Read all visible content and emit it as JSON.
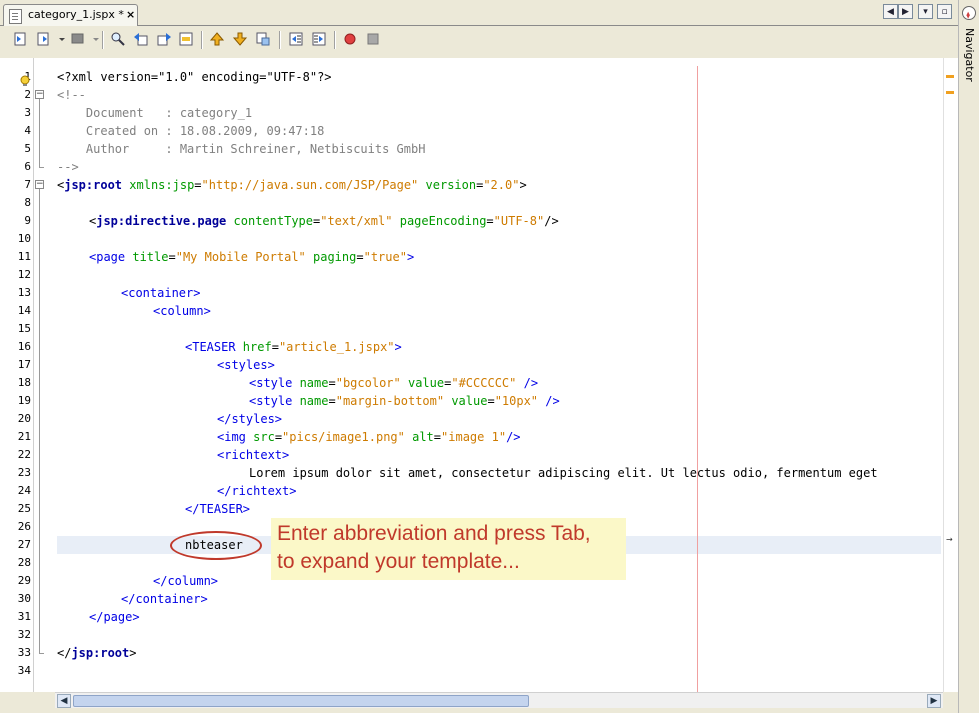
{
  "tab": {
    "title": "category_1.jspx *",
    "close_glyph": "×"
  },
  "navigator": {
    "label": "Navigator"
  },
  "tab_nav": {
    "left": "◀",
    "right": "▶",
    "menu": "▾",
    "maximize": "▫"
  },
  "editor": {
    "lines": [
      {
        "n": "1",
        "indent": 0,
        "segs": [
          {
            "c": "tx",
            "t": "<?xml version=\"1.0\" encoding=\"UTF-8\"?>"
          }
        ]
      },
      {
        "n": "2",
        "indent": 0,
        "segs": [
          {
            "c": "cm",
            "t": "<!--"
          }
        ]
      },
      {
        "n": "3",
        "indent": 0,
        "segs": [
          {
            "c": "cm",
            "t": "    Document   : category_1"
          }
        ]
      },
      {
        "n": "4",
        "indent": 0,
        "segs": [
          {
            "c": "cm",
            "t": "    Created on : 18.08.2009, 09:47:18"
          }
        ]
      },
      {
        "n": "5",
        "indent": 0,
        "segs": [
          {
            "c": "cm",
            "t": "    Author     : Martin Schreiner, Netbiscuits GmbH"
          }
        ]
      },
      {
        "n": "6",
        "indent": 0,
        "segs": [
          {
            "c": "cm",
            "t": "-->"
          }
        ]
      },
      {
        "n": "7",
        "indent": 0,
        "segs": [
          {
            "c": "tx",
            "t": "<"
          },
          {
            "c": "kw",
            "t": "jsp:root"
          },
          {
            "c": "tx",
            "t": " "
          },
          {
            "c": "attr",
            "t": "xmlns:jsp"
          },
          {
            "c": "tx",
            "t": "="
          },
          {
            "c": "val",
            "t": "\"http://java.sun.com/JSP/Page\""
          },
          {
            "c": "tx",
            "t": " "
          },
          {
            "c": "attr",
            "t": "version"
          },
          {
            "c": "tx",
            "t": "="
          },
          {
            "c": "val",
            "t": "\"2.0\""
          },
          {
            "c": "tx",
            "t": ">"
          }
        ]
      },
      {
        "n": "8",
        "indent": 0,
        "segs": []
      },
      {
        "n": "9",
        "indent": 1,
        "segs": [
          {
            "c": "tx",
            "t": "<"
          },
          {
            "c": "kw",
            "t": "jsp:directive.page"
          },
          {
            "c": "tx",
            "t": " "
          },
          {
            "c": "attr",
            "t": "contentType"
          },
          {
            "c": "tx",
            "t": "="
          },
          {
            "c": "val",
            "t": "\"text/xml\""
          },
          {
            "c": "tx",
            "t": " "
          },
          {
            "c": "attr",
            "t": "pageEncoding"
          },
          {
            "c": "tx",
            "t": "="
          },
          {
            "c": "val",
            "t": "\"UTF-8\""
          },
          {
            "c": "tx",
            "t": "/>"
          }
        ]
      },
      {
        "n": "10",
        "indent": 0,
        "segs": []
      },
      {
        "n": "11",
        "indent": 1,
        "segs": [
          {
            "c": "tag",
            "t": "<page "
          },
          {
            "c": "attr",
            "t": "title"
          },
          {
            "c": "tx",
            "t": "="
          },
          {
            "c": "val",
            "t": "\"My Mobile Portal\""
          },
          {
            "c": "tx",
            "t": " "
          },
          {
            "c": "attr",
            "t": "paging"
          },
          {
            "c": "tx",
            "t": "="
          },
          {
            "c": "val",
            "t": "\"true\""
          },
          {
            "c": "tag",
            "t": ">"
          }
        ]
      },
      {
        "n": "12",
        "indent": 0,
        "segs": []
      },
      {
        "n": "13",
        "indent": 2,
        "segs": [
          {
            "c": "tag",
            "t": "<container>"
          }
        ]
      },
      {
        "n": "14",
        "indent": 3,
        "segs": [
          {
            "c": "tag",
            "t": "<column>"
          }
        ]
      },
      {
        "n": "15",
        "indent": 0,
        "segs": []
      },
      {
        "n": "16",
        "indent": 4,
        "segs": [
          {
            "c": "tag",
            "t": "<TEASER "
          },
          {
            "c": "attr",
            "t": "href"
          },
          {
            "c": "tx",
            "t": "="
          },
          {
            "c": "val",
            "t": "\"article_1.jspx\""
          },
          {
            "c": "tag",
            "t": ">"
          }
        ]
      },
      {
        "n": "17",
        "indent": 5,
        "segs": [
          {
            "c": "tag",
            "t": "<styles>"
          }
        ]
      },
      {
        "n": "18",
        "indent": 6,
        "segs": [
          {
            "c": "tag",
            "t": "<style "
          },
          {
            "c": "attr",
            "t": "name"
          },
          {
            "c": "tx",
            "t": "="
          },
          {
            "c": "val",
            "t": "\"bgcolor\""
          },
          {
            "c": "tx",
            "t": " "
          },
          {
            "c": "attr",
            "t": "value"
          },
          {
            "c": "tx",
            "t": "="
          },
          {
            "c": "val",
            "t": "\"#CCCCCC\""
          },
          {
            "c": "tag",
            "t": " />"
          }
        ]
      },
      {
        "n": "19",
        "indent": 6,
        "segs": [
          {
            "c": "tag",
            "t": "<style "
          },
          {
            "c": "attr",
            "t": "name"
          },
          {
            "c": "tx",
            "t": "="
          },
          {
            "c": "val",
            "t": "\"margin-bottom\""
          },
          {
            "c": "tx",
            "t": " "
          },
          {
            "c": "attr",
            "t": "value"
          },
          {
            "c": "tx",
            "t": "="
          },
          {
            "c": "val",
            "t": "\"10px\""
          },
          {
            "c": "tag",
            "t": " />"
          }
        ]
      },
      {
        "n": "20",
        "indent": 5,
        "segs": [
          {
            "c": "tag",
            "t": "</styles>"
          }
        ]
      },
      {
        "n": "21",
        "indent": 5,
        "segs": [
          {
            "c": "tag",
            "t": "<img "
          },
          {
            "c": "attr",
            "t": "src"
          },
          {
            "c": "tx",
            "t": "="
          },
          {
            "c": "val",
            "t": "\"pics/image1.png\""
          },
          {
            "c": "tx",
            "t": " "
          },
          {
            "c": "attr",
            "t": "alt"
          },
          {
            "c": "tx",
            "t": "="
          },
          {
            "c": "val",
            "t": "\"image 1\""
          },
          {
            "c": "tag",
            "t": "/>"
          }
        ]
      },
      {
        "n": "22",
        "indent": 5,
        "segs": [
          {
            "c": "tag",
            "t": "<richtext>"
          }
        ]
      },
      {
        "n": "23",
        "indent": 6,
        "segs": [
          {
            "c": "tx",
            "t": "Lorem ipsum dolor sit amet, consectetur adipiscing elit. Ut lectus odio, fermentum eget"
          }
        ]
      },
      {
        "n": "24",
        "indent": 5,
        "segs": [
          {
            "c": "tag",
            "t": "</richtext>"
          }
        ]
      },
      {
        "n": "25",
        "indent": 4,
        "segs": [
          {
            "c": "tag",
            "t": "</TEASER>"
          }
        ]
      },
      {
        "n": "26",
        "indent": 0,
        "segs": []
      },
      {
        "n": "27",
        "indent": 4,
        "segs": [
          {
            "c": "tx",
            "t": "nbteaser"
          }
        ]
      },
      {
        "n": "28",
        "indent": 0,
        "segs": []
      },
      {
        "n": "29",
        "indent": 3,
        "segs": [
          {
            "c": "tag",
            "t": "</column>"
          }
        ]
      },
      {
        "n": "30",
        "indent": 2,
        "segs": [
          {
            "c": "tag",
            "t": "</container>"
          }
        ]
      },
      {
        "n": "31",
        "indent": 1,
        "segs": [
          {
            "c": "tag",
            "t": "</page>"
          }
        ]
      },
      {
        "n": "32",
        "indent": 0,
        "segs": []
      },
      {
        "n": "33",
        "indent": 0,
        "segs": [
          {
            "c": "tx",
            "t": "</"
          },
          {
            "c": "kw",
            "t": "jsp:root"
          },
          {
            "c": "tx",
            "t": ">"
          }
        ]
      },
      {
        "n": "34",
        "indent": 0,
        "segs": []
      }
    ]
  },
  "callout": {
    "line1": "Enter abbreviation and press Tab,",
    "line2": "to expand your template..."
  },
  "toolbar": {
    "icons": [
      "back-history-icon",
      "forward-history-icon",
      "last-edit-icon",
      "find-icon",
      "find-previous-icon",
      "find-next-icon",
      "toggle-highlight-icon",
      "previous-bookmark-icon",
      "next-bookmark-icon",
      "toggle-bookmark-icon",
      "shift-left-icon",
      "shift-right-icon",
      "start-macro-icon",
      "stop-macro-icon"
    ]
  },
  "colors": {
    "tag": "#0000e6",
    "attribute": "#009900",
    "value": "#ce7b00",
    "comment": "#808080",
    "callout_text": "#c0392b",
    "callout_bg": "#fbf8c8"
  }
}
